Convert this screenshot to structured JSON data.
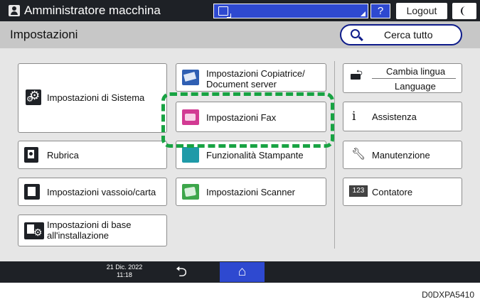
{
  "top_bar": {
    "user_label": "Amministratore macchina",
    "help_label": "?",
    "logout_label": "Logout"
  },
  "header": {
    "title": "Impostazioni",
    "search_label": "Cerca tutto"
  },
  "tiles": {
    "system": "Impostazioni di Sistema",
    "copier_line1": "Impostazioni Copiatrice/",
    "copier_line2": "Document server",
    "fax": "Impostazioni Fax",
    "address_book": "Rubrica",
    "printer": "Funzionalità Stampante",
    "tray_paper": "Impostazioni vassoio/carta",
    "scanner": "Impostazioni Scanner",
    "base_line1": "Impostazioni di base",
    "base_line2": "all'installazione",
    "lang_line1": "Cambia lingua",
    "lang_line2": "Language",
    "assistance": "Assistenza",
    "maintenance": "Manutenzione",
    "counter": "Contatore",
    "counter_icon_text": "123"
  },
  "bottom_bar": {
    "date": "21 Dic. 2022",
    "time": "11:18"
  },
  "highlight_color": "#18a343",
  "caption": "D0DXPA5410"
}
